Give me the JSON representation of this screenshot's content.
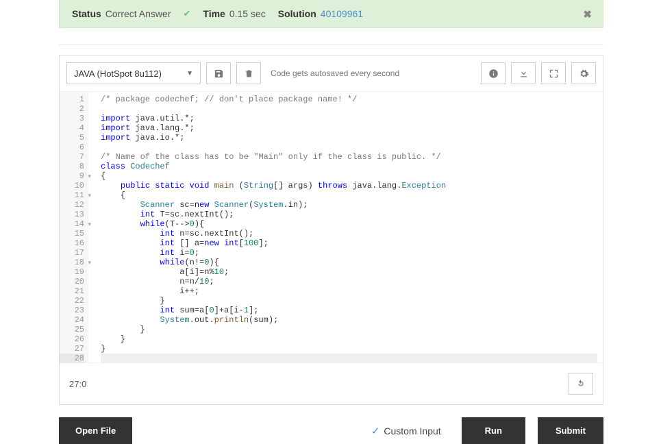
{
  "status": {
    "status_label": "Status",
    "status_value": "Correct Answer",
    "time_label": "Time",
    "time_value": "0.15 sec",
    "solution_label": "Solution",
    "solution_value": "40109961"
  },
  "toolbar": {
    "language": "JAVA (HotSpot 8u112)",
    "autosave": "Code gets autosaved every second"
  },
  "code": {
    "lines": [
      {
        "n": 1,
        "fold": false,
        "cls": "comment",
        "text": "/* package codechef; // don't place package name! */"
      },
      {
        "n": 2,
        "fold": false,
        "cls": "",
        "text": ""
      },
      {
        "n": 3,
        "fold": false,
        "cls": "import",
        "text": "import java.util.*;"
      },
      {
        "n": 4,
        "fold": false,
        "cls": "import",
        "text": "import java.lang.*;"
      },
      {
        "n": 5,
        "fold": false,
        "cls": "import",
        "text": "import java.io.*;"
      },
      {
        "n": 6,
        "fold": false,
        "cls": "",
        "text": ""
      },
      {
        "n": 7,
        "fold": false,
        "cls": "comment",
        "text": "/* Name of the class has to be \"Main\" only if the class is public. */"
      },
      {
        "n": 8,
        "fold": false,
        "cls": "class",
        "text": "class Codechef"
      },
      {
        "n": 9,
        "fold": true,
        "cls": "",
        "text": "{"
      },
      {
        "n": 10,
        "fold": false,
        "cls": "main",
        "text": "    public static void main (String[] args) throws java.lang.Exception"
      },
      {
        "n": 11,
        "fold": true,
        "cls": "",
        "text": "    {"
      },
      {
        "n": 12,
        "fold": false,
        "cls": "scanner",
        "text": "        Scanner sc=new Scanner(System.in);"
      },
      {
        "n": 13,
        "fold": false,
        "cls": "int",
        "text": "        int T=sc.nextInt();"
      },
      {
        "n": 14,
        "fold": true,
        "cls": "while",
        "text": "        while(T-->0){"
      },
      {
        "n": 15,
        "fold": false,
        "cls": "int",
        "text": "            int n=sc.nextInt();"
      },
      {
        "n": 16,
        "fold": false,
        "cls": "intarr",
        "text": "            int [] a=new int[100];"
      },
      {
        "n": 17,
        "fold": false,
        "cls": "inti",
        "text": "            int i=0;"
      },
      {
        "n": 18,
        "fold": true,
        "cls": "while2",
        "text": "            while(n!=0){"
      },
      {
        "n": 19,
        "fold": false,
        "cls": "mod",
        "text": "                a[i]=n%10;"
      },
      {
        "n": 20,
        "fold": false,
        "cls": "div",
        "text": "                n=n/10;"
      },
      {
        "n": 21,
        "fold": false,
        "cls": "",
        "text": "                i++;"
      },
      {
        "n": 22,
        "fold": false,
        "cls": "",
        "text": "            }"
      },
      {
        "n": 23,
        "fold": false,
        "cls": "sum",
        "text": "            int sum=a[0]+a[i-1];"
      },
      {
        "n": 24,
        "fold": false,
        "cls": "print",
        "text": "            System.out.println(sum);"
      },
      {
        "n": 25,
        "fold": false,
        "cls": "",
        "text": "        }"
      },
      {
        "n": 26,
        "fold": false,
        "cls": "",
        "text": "    }"
      },
      {
        "n": 27,
        "fold": false,
        "cls": "",
        "text": "}"
      },
      {
        "n": 28,
        "fold": false,
        "cls": "hl",
        "text": ""
      }
    ]
  },
  "cursor": "27:0",
  "buttons": {
    "open_file": "Open File",
    "custom_input": "Custom Input",
    "run": "Run",
    "submit": "Submit"
  }
}
